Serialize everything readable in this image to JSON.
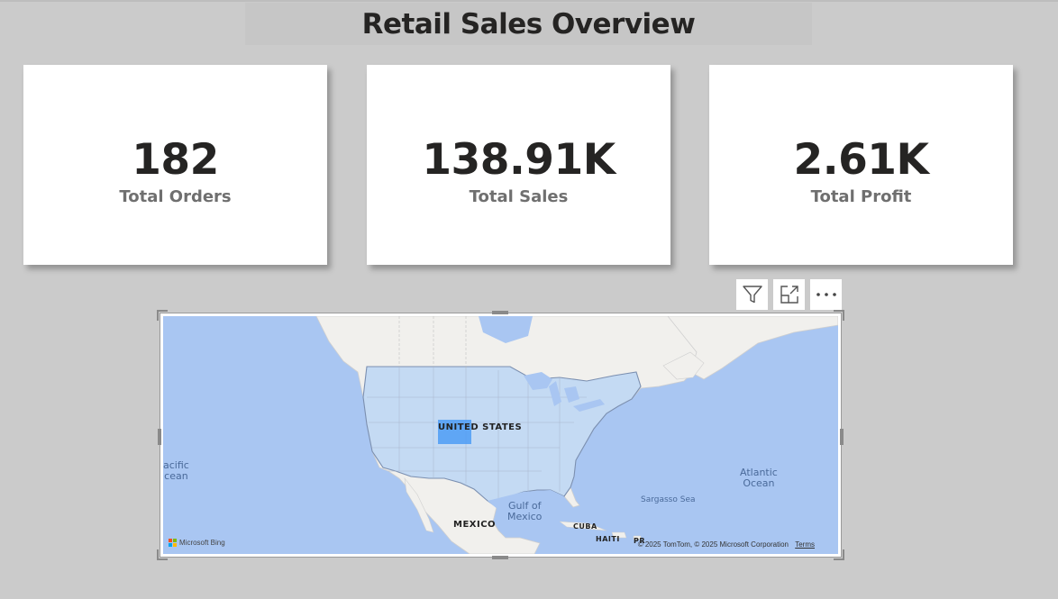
{
  "report": {
    "title": "Retail Sales Overview"
  },
  "cards": [
    {
      "value": "182",
      "label": "Total Orders"
    },
    {
      "value": "138.91K",
      "label": "Total Sales"
    },
    {
      "value": "2.61K",
      "label": "Total Profit"
    }
  ],
  "visual_header": {
    "icons": [
      "filter-icon",
      "focus-mode-icon",
      "more-options-icon"
    ]
  },
  "map": {
    "labels": {
      "united_states": "UNITED STATES",
      "mexico": "MEXICO",
      "cuba": "CUBA",
      "haiti": "HAITI",
      "pr": "PR",
      "pacific_1": "acific",
      "pacific_2": "cean",
      "gulf_1": "Gulf of",
      "gulf_2": "Mexico",
      "atlantic_1": "Atlantic",
      "atlantic_2": "Ocean",
      "sargasso": "Sargasso Sea"
    },
    "attribution": {
      "provider": "Microsoft Bing",
      "copyright": "© 2025 TomTom, © 2025 Microsoft Corporation",
      "terms": "Terms"
    },
    "colors": {
      "water": "#a9c6f2",
      "land": "#f1f0ed",
      "highlight": "#4d9cf5",
      "us_fill": "#c4daf3"
    }
  },
  "colors": {
    "canvas": "#cbcbcb",
    "card": "#ffffff",
    "value_text": "#252423",
    "label_text": "#6f6f6f"
  }
}
